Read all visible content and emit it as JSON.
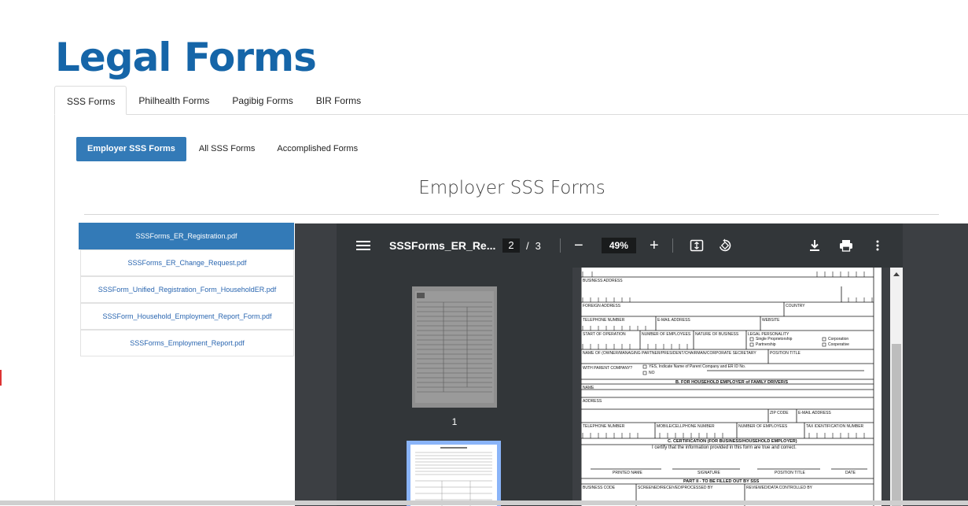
{
  "page": {
    "title": "Legal Forms"
  },
  "top_tabs": [
    {
      "label": "SSS Forms",
      "active": true
    },
    {
      "label": "Philhealth Forms",
      "active": false
    },
    {
      "label": "Pagibig Forms",
      "active": false
    },
    {
      "label": "BIR Forms",
      "active": false
    }
  ],
  "sub_tabs": [
    {
      "label": "Employer SSS Forms",
      "active": true
    },
    {
      "label": "All SSS Forms",
      "active": false
    },
    {
      "label": "Accomplished Forms",
      "active": false
    }
  ],
  "section": {
    "title": "Employer SSS Forms"
  },
  "files": [
    {
      "name": "SSSForms_ER_Registration.pdf",
      "active": true
    },
    {
      "name": "SSSForms_ER_Change_Request.pdf",
      "active": false
    },
    {
      "name": "SSSForm_Unified_Registration_Form_HouseholdER.pdf",
      "active": false
    },
    {
      "name": "SSSForm_Household_Employment_Report_Form.pdf",
      "active": false
    },
    {
      "name": "SSSForms_Employment_Report.pdf",
      "active": false
    }
  ],
  "viewer": {
    "title": "SSSForms_ER_Re...",
    "current_page": "2",
    "page_separator": "/",
    "total_pages": "3",
    "zoom": "49%",
    "zoom_out": "−",
    "zoom_in": "+",
    "thumbnail_label": "1",
    "icons": [
      "menu-icon",
      "fit-page-icon",
      "rotate-icon",
      "download-icon",
      "print-icon",
      "more-vert-icon"
    ]
  },
  "form": {
    "business_address": "BUSINESS ADDRESS",
    "foreign_address": "FOREIGN ADDRESS",
    "country": "COUNTRY",
    "telephone": "TELEPHONE NUMBER",
    "email": "E-MAIL ADDRESS",
    "website": "WEBSITE",
    "start_operation": "START OF OPERATION",
    "num_employees": "NUMBER OF EMPLOYEES",
    "nature_business": "NATURE OF BUSINESS",
    "legal_personality": "LEGAL PERSONALITY",
    "single_prop": "Single Proprietorship",
    "partnership": "Partnership",
    "corporation": "Corporation",
    "cooperative": "Cooperative",
    "owner_name": "NAME OF (OWNER/MANAGING PARTNER/PRESIDENT/CHAIRMAN/CORPORATE SECRETARY",
    "position_title": "POSITION TITLE",
    "parent_company": "WITH PARENT COMPANY?",
    "yes_label": "YES, Indicate Name of Parent Company and ER ID No.",
    "no_label": "NO",
    "section_b": "B.  FOR HOUSEHOLD EMPLOYER of FAMILY DRIVER/S",
    "name": "NAME",
    "address": "ADDRESS",
    "zip_code": "ZIP CODE",
    "mobile": "MOBILE/CELLPHONE NUMBER",
    "tin": "TAX IDENTIFICATION NUMBER",
    "section_c": "C.  CERTIFICATION (FOR BUSINESS/HOUSEHOLD EMPLOYER)",
    "certify": "I certify that the information provided in this form are true and correct.",
    "printed_name": "PRINTED NAME",
    "signature": "SIGNATURE",
    "position": "POSITION TITLE",
    "date": "DATE",
    "part2": "PART II - TO BE FILLED OUT BY SSS",
    "business_code": "BUSINESS CODE",
    "screened": "SCREENED/RECEIVED/PROCESSED BY",
    "reviewed": "REVIEWED/DATA CONTROLLED BY"
  }
}
